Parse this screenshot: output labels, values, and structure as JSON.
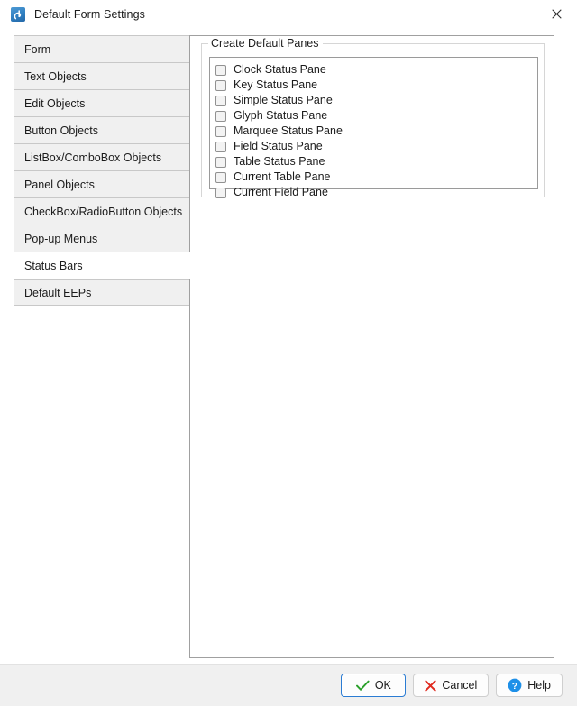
{
  "window": {
    "title": "Default Form Settings",
    "app_icon": "application-icon",
    "close_icon": "close-icon"
  },
  "sidebar": {
    "items": [
      {
        "label": "Form",
        "selected": false
      },
      {
        "label": "Text Objects",
        "selected": false
      },
      {
        "label": "Edit Objects",
        "selected": false
      },
      {
        "label": "Button Objects",
        "selected": false
      },
      {
        "label": "ListBox/ComboBox Objects",
        "selected": false
      },
      {
        "label": "Panel Objects",
        "selected": false
      },
      {
        "label": "CheckBox/RadioButton Objects",
        "selected": false
      },
      {
        "label": "Pop-up Menus",
        "selected": false
      },
      {
        "label": "Status Bars",
        "selected": true
      },
      {
        "label": "Default EEPs",
        "selected": false
      }
    ]
  },
  "content": {
    "group_title": "Create Default Panes",
    "panes": [
      {
        "label": "Clock Status Pane",
        "checked": false
      },
      {
        "label": "Key Status Pane",
        "checked": false
      },
      {
        "label": "Simple Status Pane",
        "checked": false
      },
      {
        "label": "Glyph Status Pane",
        "checked": false
      },
      {
        "label": "Marquee Status Pane",
        "checked": false
      },
      {
        "label": "Field Status Pane",
        "checked": false
      },
      {
        "label": "Table Status Pane",
        "checked": false
      },
      {
        "label": "Current Table Pane",
        "checked": false
      },
      {
        "label": "Current Field Pane",
        "checked": false
      }
    ]
  },
  "footer": {
    "ok_label": "OK",
    "cancel_label": "Cancel",
    "help_label": "Help",
    "ok_icon": "check-icon",
    "cancel_icon": "cross-icon",
    "help_icon": "question-circle-icon"
  },
  "colors": {
    "accent": "#2b7cd3",
    "ok_check": "#2aa02a",
    "cancel_cross": "#e02b20",
    "help_circle": "#1e90e8",
    "window_bg": "#ffffff",
    "footer_bg": "#f0f0f0",
    "tab_bg": "#f0f0f0"
  }
}
